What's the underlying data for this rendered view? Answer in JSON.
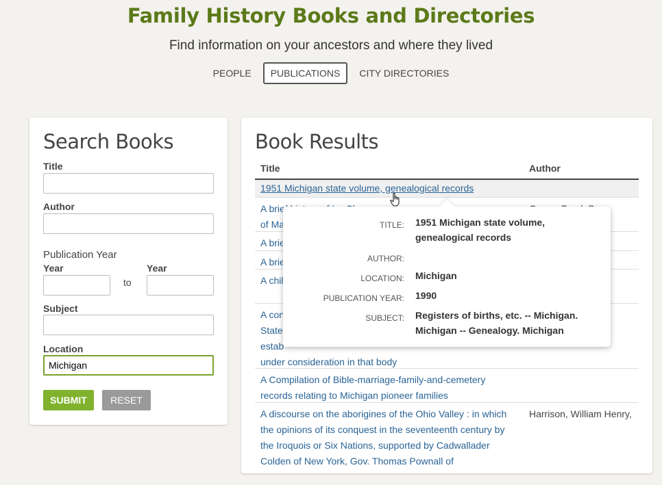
{
  "header": {
    "title": "Family History Books and Directories",
    "subtitle": "Find information on your ancestors and where they lived"
  },
  "nav": {
    "people": "PEOPLE",
    "publications": "PUBLICATIONS",
    "city_directories": "CITY DIRECTORIES",
    "active": "publications"
  },
  "search": {
    "heading": "Search Books",
    "title_label": "Title",
    "title_value": "",
    "author_label": "Author",
    "author_value": "",
    "pub_year_label": "Publication Year",
    "year_from_label": "Year",
    "year_to_label": "Year",
    "to_label": "to",
    "subject_label": "Subject",
    "subject_value": "",
    "location_label": "Location",
    "location_value": "Michigan",
    "submit_label": "SUBMIT",
    "reset_label": "RESET"
  },
  "results": {
    "heading": "Book Results",
    "col_title": "Title",
    "col_author": "Author",
    "rows": [
      {
        "title": "1951 Michigan state volume, genealogical records",
        "author": ""
      },
      {
        "title": "A brief history of Ira Chaseand a ... of Marion Chase",
        "author": "Green, Frank B."
      },
      {
        "title": "A brief",
        "author": ""
      },
      {
        "title": "A brief",
        "author": ""
      },
      {
        "title": "A chil",
        "author": ""
      },
      {
        "title": "A compilation ... State ... established ... under consideration in that body",
        "author": ""
      },
      {
        "title": "A Compilation of Bible-marriage-family-and-cemetery records relating to Michigan pioneer families",
        "author": ""
      },
      {
        "title": "A discourse on the aborigines of the Ohio Valley : in which the opinions of its conquest in the seventeenth century by the Iroquois or Six Nations, supported by Cadwallader Colden of New York, Gov. Thomas Pownall of",
        "author": "Harrison, William Henry,"
      }
    ],
    "visible": {
      "row0": "1951 Michigan state volume, genealogical records",
      "row1a": "A brief history of Ira Chase",
      "row1b": "of Ma",
      "row1_author": "Green, Frank B.",
      "row2": "A brie",
      "row3": "A brie",
      "row4": "A chil",
      "row5a": "A con",
      "row5b": "State",
      "row5c": "estab",
      "row5d": "under consideration in that body",
      "row6a": "A Compilation of Bible-marriage-family-and-cemetery",
      "row6b": "records relating to Michigan pioneer families",
      "row7a": "A discourse on the aborigines of the Ohio Valley : in which",
      "row7b": "the opinions of its conquest in the seventeenth century by",
      "row7c": "the Iroquois or Six Nations, supported by Cadwallader",
      "row7d": "Colden of New York, Gov. Thomas Pownall of",
      "row7_author": "Harrison, William Henry,"
    }
  },
  "tooltip": {
    "title_label": "TITLE:",
    "title_value": "1951 Michigan state volume, genealogical records",
    "author_label": "AUTHOR:",
    "author_value": "",
    "location_label": "LOCATION:",
    "location_value": "Michigan",
    "pub_year_label": "PUBLICATION YEAR:",
    "pub_year_value": "1990",
    "subject_label": "SUBJECT:",
    "subject_value": "Registers of births, etc. -- Michigan. Michigan -- Genealogy. Michigan"
  },
  "colors": {
    "brand_green": "#5b7a19",
    "submit_green": "#80b22d",
    "link_blue": "#2a6496",
    "reset_gray": "#9a9a9a"
  }
}
